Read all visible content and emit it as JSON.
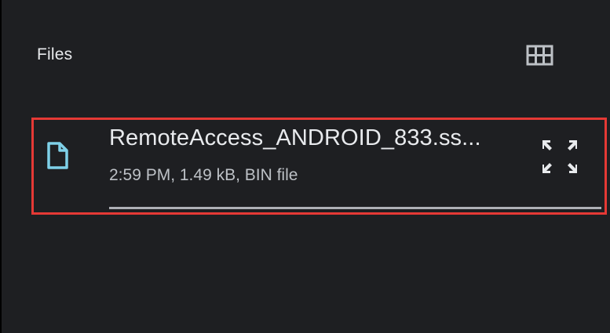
{
  "section": {
    "title": "Files"
  },
  "icons": {
    "grid_toggle": "grid-view-icon",
    "file": "file-icon",
    "expand": "fullscreen-expand-icon"
  },
  "download": {
    "file_name": "RemoteAccess_ANDROID_833.ss...",
    "meta": "2:59 PM, 1.49 kB, BIN file",
    "progress": 1.0
  },
  "colors": {
    "background": "#1e1f22",
    "text_primary": "#e8eaed",
    "text_secondary": "#bdc1c6",
    "file_icon": "#7fd0e8",
    "highlight_border": "#e53935"
  }
}
